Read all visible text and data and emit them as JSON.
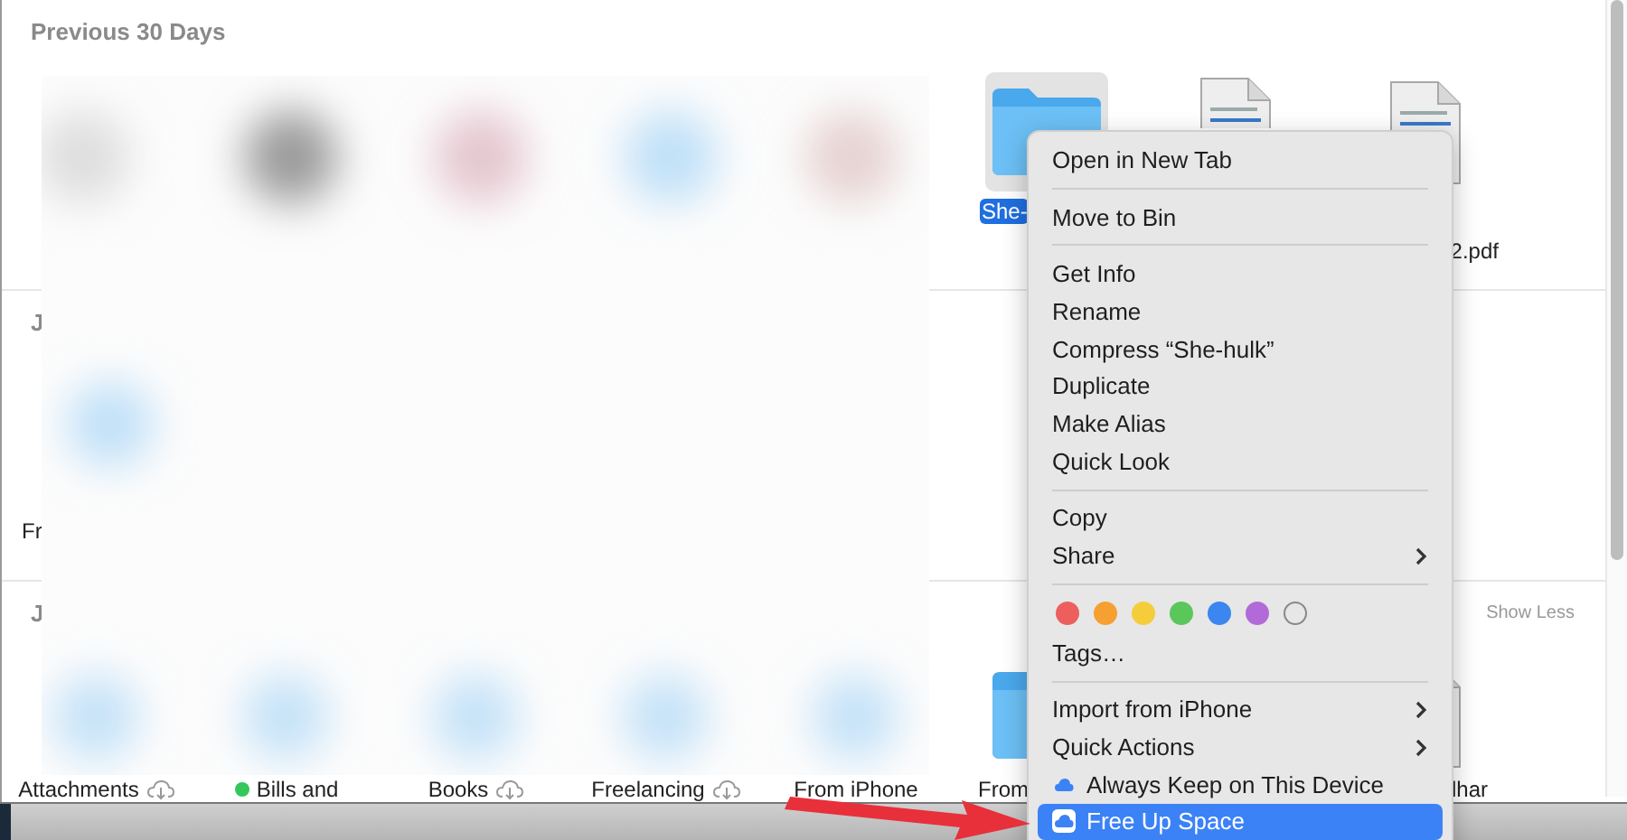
{
  "sections": [
    {
      "title": "Previous 30 Days",
      "items": [
        {
          "kind": "folder",
          "label": "She-",
          "selected": true,
          "cloud": false
        },
        {
          "kind": "document_top",
          "selected": false,
          "cloud": false
        },
        {
          "kind": "document",
          "label": "2.pdf",
          "selected": false,
          "cloud": false
        }
      ]
    },
    {
      "title": "J",
      "items": [
        {
          "kind": "blank",
          "label": "Fr",
          "selected": false,
          "cloud": false
        }
      ]
    },
    {
      "title": "J",
      "link": "Show Less",
      "items": [
        {
          "kind": "blank",
          "label": "Attachments",
          "selected": false,
          "cloud": true
        },
        {
          "kind": "blank",
          "label": "Bills and",
          "selected": false,
          "cloud": false,
          "color": "#34c759"
        },
        {
          "kind": "blank",
          "label": "Books",
          "selected": false,
          "cloud": true
        },
        {
          "kind": "blank",
          "label": "Freelancing",
          "selected": false,
          "cloud": true
        },
        {
          "kind": "blank",
          "label": "From iPhone",
          "selected": false,
          "cloud": false
        },
        {
          "kind": "folder",
          "label": "From",
          "selected": false,
          "cloud": false
        },
        {
          "kind": "document",
          "label": "lhar",
          "selected": false,
          "cloud": false
        }
      ]
    }
  ],
  "menu": {
    "groups": [
      [
        {
          "kind": "item",
          "label": "Open in New Tab",
          "submenu": false,
          "selected": false
        }
      ],
      [
        {
          "kind": "item",
          "label": "Move to Bin",
          "submenu": false,
          "selected": false
        }
      ],
      [
        {
          "kind": "item",
          "label": "Get Info",
          "submenu": false,
          "selected": false
        },
        {
          "kind": "item",
          "label": "Rename",
          "submenu": false,
          "selected": false
        },
        {
          "kind": "item",
          "label": "Compress “She-hulk”",
          "submenu": false,
          "selected": false
        },
        {
          "kind": "item",
          "label": "Duplicate",
          "submenu": false,
          "selected": false
        },
        {
          "kind": "item",
          "label": "Make Alias",
          "submenu": false,
          "selected": false
        },
        {
          "kind": "item",
          "label": "Quick Look",
          "submenu": false,
          "selected": false
        }
      ],
      [
        {
          "kind": "item",
          "label": "Copy",
          "submenu": false,
          "selected": false
        },
        {
          "kind": "item",
          "label": "Share",
          "submenu": true,
          "selected": false
        }
      ],
      [
        {
          "kind": "tags",
          "colors": [
            {
              "color": "#ec5f5d"
            },
            {
              "color": "#f5a030"
            },
            {
              "color": "#f5cd3a"
            },
            {
              "color": "#5ac75a"
            },
            {
              "color": "#3b86f0"
            },
            {
              "color": "#b36ad9"
            },
            {
              "empty": true
            }
          ]
        },
        {
          "kind": "item",
          "label": "Tags…",
          "submenu": false,
          "selected": false
        }
      ],
      [
        {
          "kind": "item",
          "label": "Import from iPhone",
          "submenu": true,
          "selected": false
        },
        {
          "kind": "item",
          "label": "Quick Actions",
          "submenu": true,
          "selected": false
        },
        {
          "kind": "icloud",
          "label": "Always Keep on This Device",
          "submenu": false,
          "selected": false
        },
        {
          "kind": "icloud",
          "label": "Free Up Space",
          "submenu": false,
          "selected": true
        }
      ]
    ]
  }
}
